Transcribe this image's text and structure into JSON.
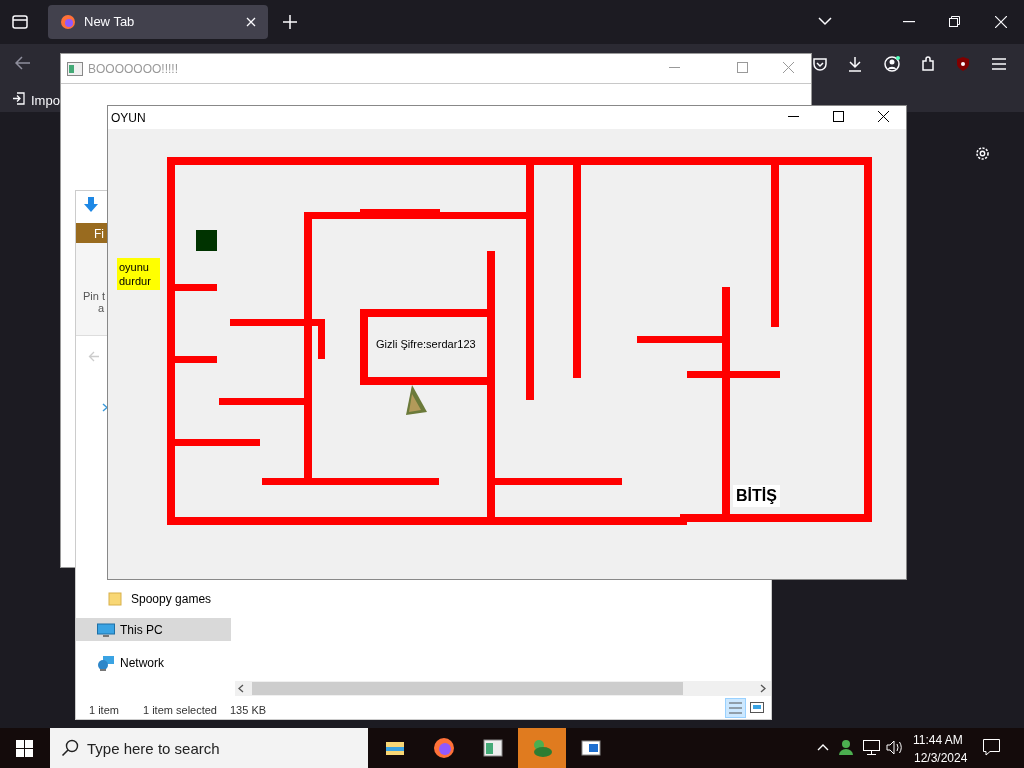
{
  "browser": {
    "tabs": [
      {
        "label": "New Tab",
        "selected": true
      }
    ],
    "bookmarks": [
      {
        "label": "Impo"
      }
    ]
  },
  "back_window": {
    "title": "BOOOOOOO!!!!!"
  },
  "explorer": {
    "ribbon_tab": "Fi",
    "pin_text": [
      "Pin t",
      "a"
    ],
    "nav_items": [
      {
        "label": "Spoopy games",
        "kind": "folder",
        "selected": false
      },
      {
        "label": "This PC",
        "kind": "pc",
        "selected": true
      },
      {
        "label": "Network",
        "kind": "network",
        "selected": false
      }
    ],
    "status": [
      "1 item",
      "1 item selected",
      "135 KB"
    ]
  },
  "game_window": {
    "title": "OYUN",
    "pause_button": "oyunu durdur",
    "secret_label": "Gizli Şifre:serdar123",
    "finish_label": "BİTİŞ"
  },
  "taskbar": {
    "search_placeholder": "Type here to search",
    "apps": [
      {
        "kind": "explorer",
        "selected": false
      },
      {
        "kind": "firefox",
        "selected": false
      },
      {
        "kind": "window",
        "selected": false
      },
      {
        "kind": "game",
        "selected": true
      },
      {
        "kind": "window2",
        "selected": false
      }
    ],
    "time": "11:44 AM",
    "date": "12/3/2024"
  }
}
